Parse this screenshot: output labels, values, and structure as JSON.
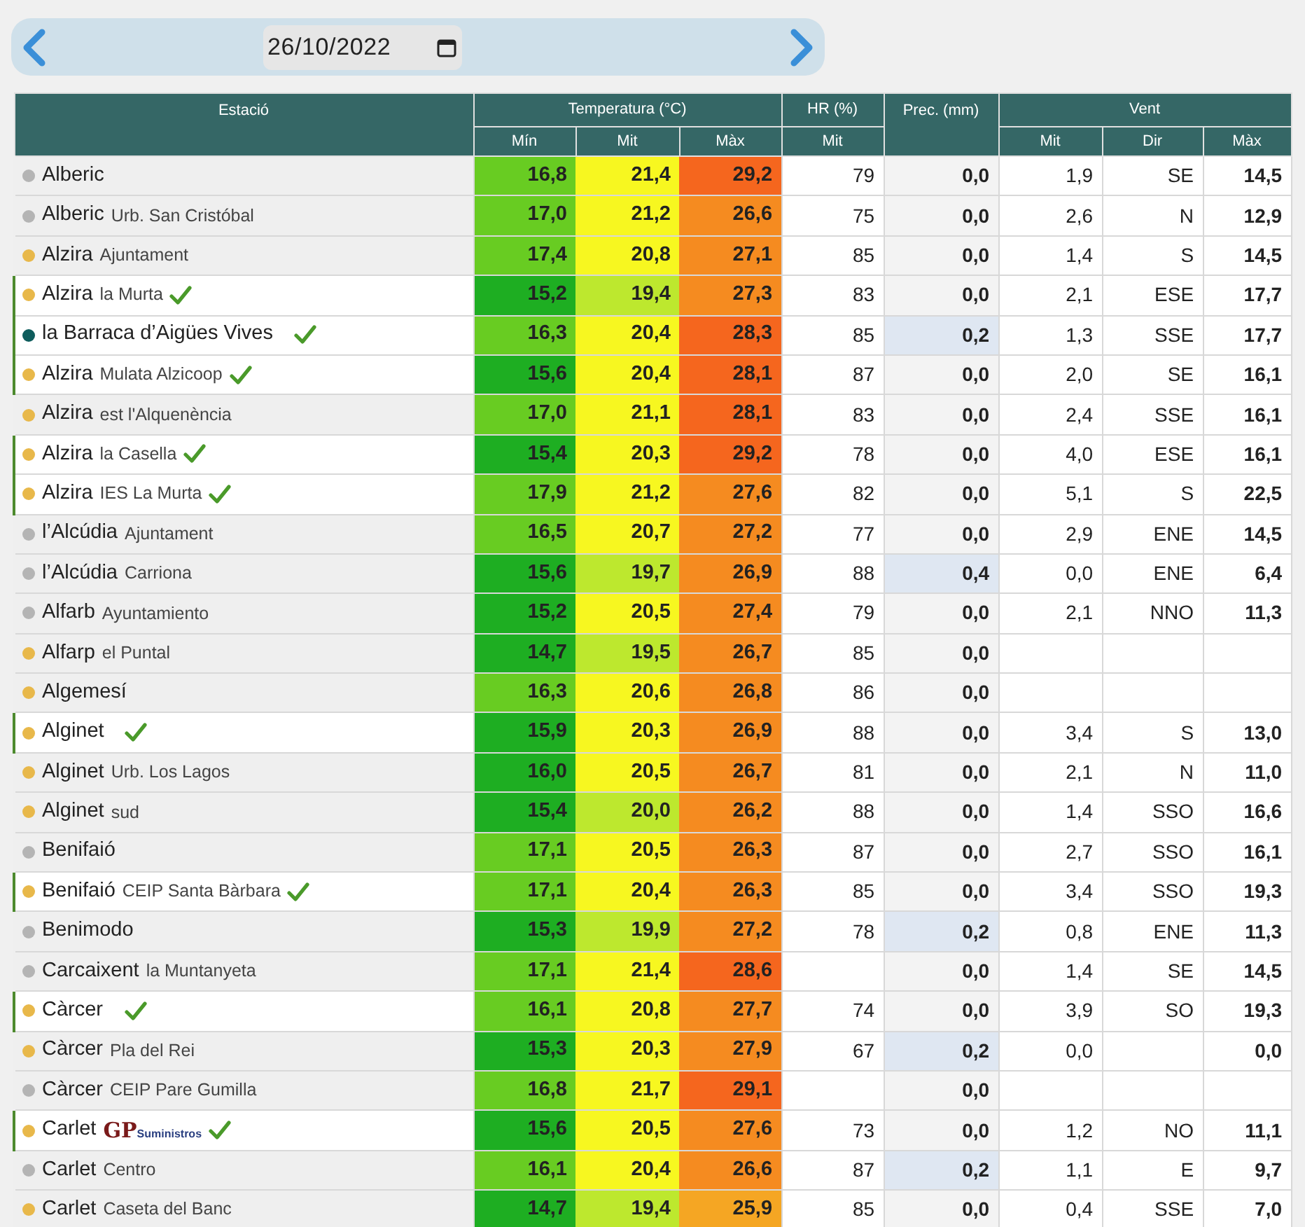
{
  "date_picker": {
    "value": "26/10/2022"
  },
  "table": {
    "header_groups": [
      "Estació",
      "Temperatura (°C)",
      "HR (%)",
      "Prec. (mm)",
      "Vent"
    ],
    "sub_headers": [
      "Mín",
      "Mit",
      "Màx",
      "Mit",
      "Mit",
      "Dir",
      "Màx"
    ],
    "rows": [
      {
        "name": "Alberic",
        "color": "#b4b4b4",
        "verified": false,
        "min": "16,8",
        "mit": "21,4",
        "max": "29,2",
        "hr": "79",
        "prec": "0,0",
        "wind_mit": "1,9",
        "wind_dir": "SE",
        "wind_max": "14,5"
      },
      {
        "name": "Alberic",
        "sub": "Urb. San Cristóbal",
        "color": "#b4b4b4",
        "verified": false,
        "min": "17,0",
        "mit": "21,2",
        "max": "26,6",
        "hr": "75",
        "prec": "0,0",
        "wind_mit": "2,6",
        "wind_dir": "N",
        "wind_max": "12,9"
      },
      {
        "name": "Alzira",
        "sub": "Ajuntament",
        "color": "#e8b84a",
        "verified": false,
        "min": "17,4",
        "mit": "20,8",
        "max": "27,1",
        "hr": "85",
        "prec": "0,0",
        "wind_mit": "1,4",
        "wind_dir": "S",
        "wind_max": "14,5"
      },
      {
        "name": "Alzira",
        "sub": "la Murta",
        "color": "#e8b84a",
        "verified": true,
        "min": "15,2",
        "mit": "19,4",
        "max": "27,3",
        "hr": "83",
        "prec": "0,0",
        "wind_mit": "2,1",
        "wind_dir": "ESE",
        "wind_max": "17,7"
      },
      {
        "name": "la Barraca d’Aigües Vives",
        "color": "#0e5c5c",
        "verified": true,
        "min": "16,3",
        "mit": "20,4",
        "max": "28,3",
        "hr": "85",
        "prec": "0,2",
        "wind_mit": "1,3",
        "wind_dir": "SSE",
        "wind_max": "17,7"
      },
      {
        "name": "Alzira",
        "sub": "Mulata Alzicoop",
        "color": "#e8b84a",
        "verified": true,
        "min": "15,6",
        "mit": "20,4",
        "max": "28,1",
        "hr": "87",
        "prec": "0,0",
        "wind_mit": "2,0",
        "wind_dir": "SE",
        "wind_max": "16,1"
      },
      {
        "name": "Alzira",
        "sub": "est l'Alquenència",
        "color": "#e8b84a",
        "verified": false,
        "min": "17,0",
        "mit": "21,1",
        "max": "28,1",
        "hr": "83",
        "prec": "0,0",
        "wind_mit": "2,4",
        "wind_dir": "SSE",
        "wind_max": "16,1"
      },
      {
        "name": "Alzira",
        "sub": "la Casella",
        "color": "#e8b84a",
        "verified": true,
        "min": "15,4",
        "mit": "20,3",
        "max": "29,2",
        "hr": "78",
        "prec": "0,0",
        "wind_mit": "4,0",
        "wind_dir": "ESE",
        "wind_max": "16,1"
      },
      {
        "name": "Alzira",
        "sub": "IES La Murta",
        "color": "#e8b84a",
        "verified": true,
        "min": "17,9",
        "mit": "21,2",
        "max": "27,6",
        "hr": "82",
        "prec": "0,0",
        "wind_mit": "5,1",
        "wind_dir": "S",
        "wind_max": "22,5"
      },
      {
        "name": "l’Alcúdia",
        "sub": "Ajuntament",
        "color": "#b4b4b4",
        "verified": false,
        "min": "16,5",
        "mit": "20,7",
        "max": "27,2",
        "hr": "77",
        "prec": "0,0",
        "wind_mit": "2,9",
        "wind_dir": "ENE",
        "wind_max": "14,5"
      },
      {
        "name": "l’Alcúdia",
        "sub": "Carriona",
        "color": "#b4b4b4",
        "verified": false,
        "min": "15,6",
        "mit": "19,7",
        "max": "26,9",
        "hr": "88",
        "prec": "0,4",
        "wind_mit": "0,0",
        "wind_dir": "ENE",
        "wind_max": "6,4"
      },
      {
        "name": "Alfarb",
        "sub": "Ayuntamiento",
        "color": "#b4b4b4",
        "verified": false,
        "min": "15,2",
        "mit": "20,5",
        "max": "27,4",
        "hr": "79",
        "prec": "0,0",
        "wind_mit": "2,1",
        "wind_dir": "NNO",
        "wind_max": "11,3"
      },
      {
        "name": "Alfarp",
        "sub": "el Puntal",
        "color": "#e8b84a",
        "verified": false,
        "min": "14,7",
        "mit": "19,5",
        "max": "26,7",
        "hr": "85",
        "prec": "0,0"
      },
      {
        "name": "Algemesí",
        "color": "#e8b84a",
        "verified": false,
        "min": "16,3",
        "mit": "20,6",
        "max": "26,8",
        "hr": "86",
        "prec": "0,0"
      },
      {
        "name": "Alginet",
        "color": "#e8b84a",
        "verified": true,
        "min": "15,9",
        "mit": "20,3",
        "max": "26,9",
        "hr": "88",
        "prec": "0,0",
        "wind_mit": "3,4",
        "wind_dir": "S",
        "wind_max": "13,0"
      },
      {
        "name": "Alginet",
        "sub": "Urb. Los Lagos",
        "color": "#e8b84a",
        "verified": false,
        "min": "16,0",
        "mit": "20,5",
        "max": "26,7",
        "hr": "81",
        "prec": "0,0",
        "wind_mit": "2,1",
        "wind_dir": "N",
        "wind_max": "11,0"
      },
      {
        "name": "Alginet",
        "sub": "sud",
        "color": "#e8b84a",
        "verified": false,
        "min": "15,4",
        "mit": "20,0",
        "max": "26,2",
        "hr": "88",
        "prec": "0,0",
        "wind_mit": "1,4",
        "wind_dir": "SSO",
        "wind_max": "16,6"
      },
      {
        "name": "Benifaió",
        "color": "#b4b4b4",
        "verified": false,
        "min": "17,1",
        "mit": "20,5",
        "max": "26,3",
        "hr": "87",
        "prec": "0,0",
        "wind_mit": "2,7",
        "wind_dir": "SSO",
        "wind_max": "16,1"
      },
      {
        "name": "Benifaió",
        "sub": "CEIP Santa Bàrbara",
        "color": "#e8b84a",
        "verified": true,
        "min": "17,1",
        "mit": "20,4",
        "max": "26,3",
        "hr": "85",
        "prec": "0,0",
        "wind_mit": "3,4",
        "wind_dir": "SSO",
        "wind_max": "19,3"
      },
      {
        "name": "Benimodo",
        "color": "#b4b4b4",
        "verified": false,
        "min": "15,3",
        "mit": "19,9",
        "max": "27,2",
        "hr": "78",
        "prec": "0,2",
        "wind_mit": "0,8",
        "wind_dir": "ENE",
        "wind_max": "11,3"
      },
      {
        "name": "Carcaixent",
        "sub": "la Muntanyeta",
        "color": "#b4b4b4",
        "verified": false,
        "min": "17,1",
        "mit": "21,4",
        "max": "28,6",
        "prec": "0,0",
        "wind_mit": "1,4",
        "wind_dir": "SE",
        "wind_max": "14,5"
      },
      {
        "name": "Càrcer",
        "color": "#e8b84a",
        "verified": true,
        "min": "16,1",
        "mit": "20,8",
        "max": "27,7",
        "hr": "74",
        "prec": "0,0",
        "wind_mit": "3,9",
        "wind_dir": "SO",
        "wind_max": "19,3"
      },
      {
        "name": "Càrcer",
        "sub": "Pla del Rei",
        "color": "#e8b84a",
        "verified": false,
        "min": "15,3",
        "mit": "20,3",
        "max": "27,9",
        "hr": "67",
        "prec": "0,2",
        "wind_mit": "0,0",
        "wind_max": "0,0"
      },
      {
        "name": "Càrcer",
        "sub": "CEIP Pare Gumilla",
        "color": "#b4b4b4",
        "verified": false,
        "min": "16,8",
        "mit": "21,7",
        "max": "29,1",
        "prec": "0,0"
      },
      {
        "name": "Carlet",
        "logo": [
          "GP",
          "Suministros"
        ],
        "color": "#e8b84a",
        "verified": true,
        "min": "15,6",
        "mit": "20,5",
        "max": "27,6",
        "hr": "73",
        "prec": "0,0",
        "wind_mit": "1,2",
        "wind_dir": "NO",
        "wind_max": "11,1"
      },
      {
        "name": "Carlet",
        "sub": "Centro",
        "color": "#b4b4b4",
        "verified": false,
        "min": "16,1",
        "mit": "20,4",
        "max": "26,6",
        "hr": "87",
        "prec": "0,2",
        "wind_mit": "1,1",
        "wind_dir": "E",
        "wind_max": "9,7"
      },
      {
        "name": "Carlet",
        "sub": "Caseta del Banc",
        "color": "#e8b84a",
        "verified": false,
        "min": "14,7",
        "mit": "19,4",
        "max": "25,9",
        "hr": "85",
        "prec": "0,0",
        "wind_mit": "0,4",
        "wind_dir": "SSE",
        "wind_max": "7,0"
      }
    ]
  }
}
